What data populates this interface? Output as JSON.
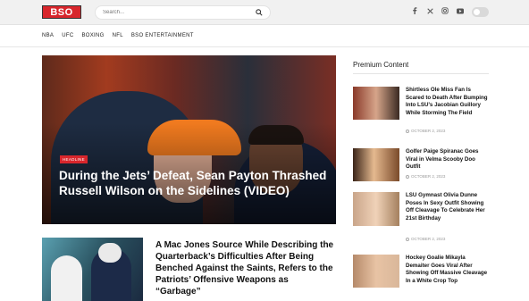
{
  "header": {
    "logo_text": "BSO",
    "search_placeholder": "Search...",
    "social_icons": [
      "facebook-icon",
      "x-icon",
      "instagram-icon",
      "youtube-icon"
    ],
    "brand_color": "#d8262c"
  },
  "nav": {
    "items": [
      "NBA",
      "UFC",
      "BOXING",
      "NFL",
      "BSO ENTERTAINMENT"
    ]
  },
  "hero": {
    "badge": "HEADLINE",
    "title": "During the Jets’ Defeat, Sean Payton Thrashed Russell Wilson on the Sidelines (VIDEO)"
  },
  "article2": {
    "title": "A Mac Jones Source While Describing the Quarterback’s Difficulties After Being Benched Against the Saints, Refers to the Patriots’ Offensive Weapons as “Garbage”"
  },
  "sidebar": {
    "heading": "Premium Content",
    "items": [
      {
        "title": "Shirtless Ole Miss Fan Is Scared to Death After Bumping Into LSU’s Jacobian Guillory While Storming The Field",
        "date": "OCTOBER 2, 2023"
      },
      {
        "title": "Golfer Paige Spiranac Goes Viral in Velma Scooby Doo Outfit",
        "date": "OCTOBER 2, 2023"
      },
      {
        "title": "LSU Gymnast Olivia Dunne Poses In Sexy Outfit Showing Off Cleavage To Celebrate Her 21st Birthday",
        "date": "OCTOBER 2, 2023"
      },
      {
        "title": "Hockey Goalie Mikayla Demaiter Goes Viral After Showing Off Massive Cleavage In a White Crop Top",
        "date": ""
      }
    ]
  }
}
